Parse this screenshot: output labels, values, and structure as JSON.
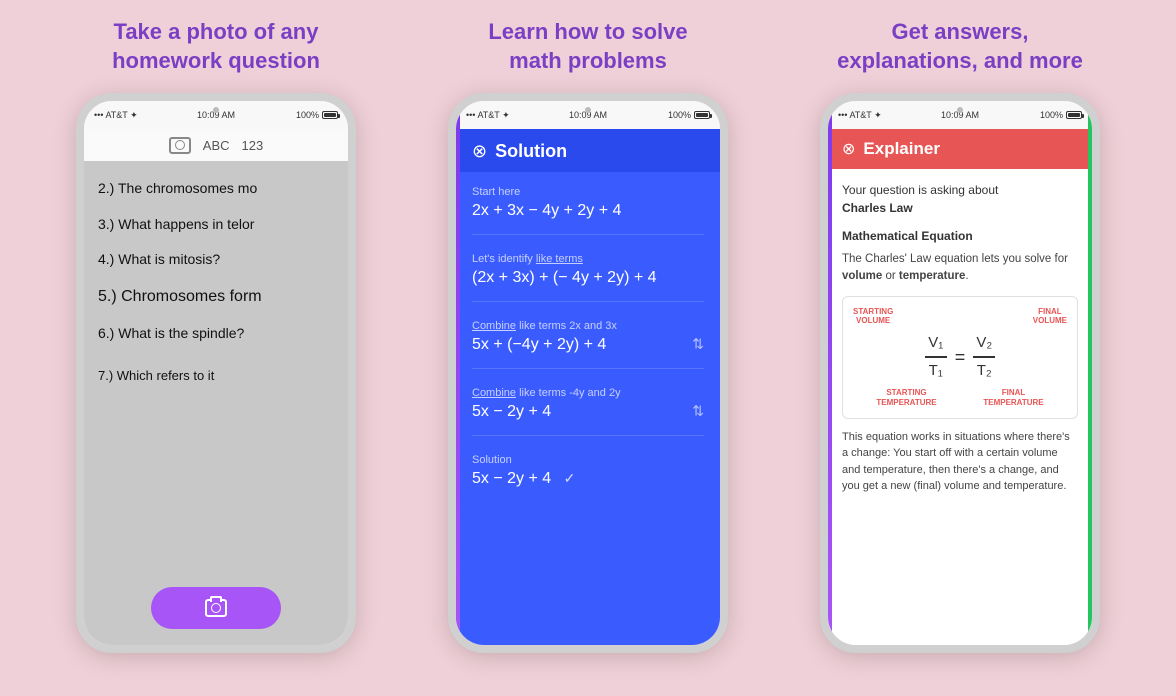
{
  "background_color": "#f0d0d8",
  "panels": [
    {
      "id": "panel1",
      "title": "Take a photo of any\nhomework question",
      "phone": {
        "status_left": "••• AT&T ✦",
        "status_time": "10:09 AM",
        "status_right": "100%",
        "screen_type": "camera",
        "camera_bar_icon": "camera",
        "camera_bar_text1": "ABC",
        "camera_bar_text2": "123",
        "questions": [
          "2.) The chromosomes mo",
          "3.) What happens in telor",
          "4.) What is mitosis?",
          "5.) Chromosomes form",
          "6.) What is the spindle?",
          "7.) Which refers to it"
        ]
      }
    },
    {
      "id": "panel2",
      "title": "Learn how to solve\nmath problems",
      "phone": {
        "status_left": "••• AT&T ✦",
        "status_time": "10:09 AM",
        "status_right": "100%",
        "screen_type": "solution",
        "header_icon": "◎",
        "header_title": "Solution",
        "steps": [
          {
            "label": "Start here",
            "expr": "2x + 3x − 4y + 2y + 4",
            "has_expand": false,
            "has_check": false
          },
          {
            "label": "Let's identify like terms",
            "expr": "(2x + 3x) + (− 4y + 2y) + 4",
            "has_expand": false,
            "has_check": false
          },
          {
            "label": "Combine like terms 2x and 3x",
            "expr": "5x + (−4y + 2y) + 4",
            "has_expand": true,
            "has_check": false
          },
          {
            "label": "Combine like terms -4y and 2y",
            "expr": "5x − 2y + 4",
            "has_expand": true,
            "has_check": false
          },
          {
            "label": "Solution",
            "expr": "5x − 2y + 4",
            "has_expand": false,
            "has_check": true
          }
        ]
      }
    },
    {
      "id": "panel3",
      "title": "Get answers,\nexplanations, and more",
      "phone": {
        "status_left": "••• AT&T ✦",
        "status_time": "10:09 AM",
        "status_right": "100%",
        "screen_type": "explainer",
        "header_icon": "◎",
        "header_title": "Explainer",
        "intro": "Your question is asking about",
        "intro_bold": "Charles Law",
        "section_title": "Mathematical Equation",
        "section_desc1": "The Charles' Law equation lets you solve for",
        "section_desc_bold1": "volume",
        "section_desc2": "or",
        "section_desc_bold2": "temperature",
        "section_desc3": ".",
        "diagram": {
          "top_left": "STARTING\nVOLUME",
          "top_right": "FINAL\nVOLUME",
          "num1": "V₁",
          "den1": "T₁",
          "equals": "=",
          "num2": "V₂",
          "den2": "T₂",
          "bottom_left": "STARTING\nTEMPERATURE",
          "bottom_right": "FINAL\nTEMPERATURE"
        },
        "footer": "This equation works in situations where there's a change: You start off with a certain volume and temperature, then there's a change, and you get a new (final) volume and temperature."
      }
    }
  ]
}
